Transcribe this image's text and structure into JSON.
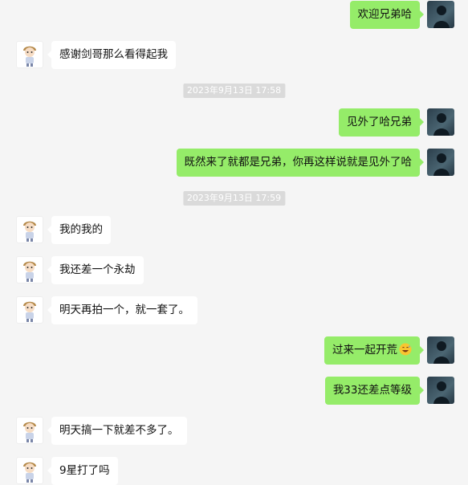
{
  "timestamps": [
    "2023年9月13日 17:58",
    "2023年9月13日 17:59"
  ],
  "messages": [
    {
      "side": "out",
      "text": "欢迎兄弟哈"
    },
    {
      "side": "in",
      "text": "感谢剑哥那么看得起我"
    },
    {
      "side": "out",
      "text": "见外了哈兄弟"
    },
    {
      "side": "out",
      "text": "既然来了就都是兄弟，你再这样说就是见外了哈"
    },
    {
      "side": "in",
      "text": "我的我的"
    },
    {
      "side": "in",
      "text": "我还差一个永劫"
    },
    {
      "side": "in",
      "text": "明天再拍一个，就一套了。"
    },
    {
      "side": "out",
      "text": "过来一起开荒",
      "emoji": "grinning-sweat-emoji"
    },
    {
      "side": "out",
      "text": "我33还差点等级"
    },
    {
      "side": "in",
      "text": "明天搞一下就差不多了。"
    },
    {
      "side": "in",
      "text": "9星打了吗"
    }
  ],
  "colors": {
    "background": "#f5f5f5",
    "outgoing_bubble": "#95ec69",
    "incoming_bubble": "#ffffff",
    "timestamp_bg": "#dadada"
  }
}
